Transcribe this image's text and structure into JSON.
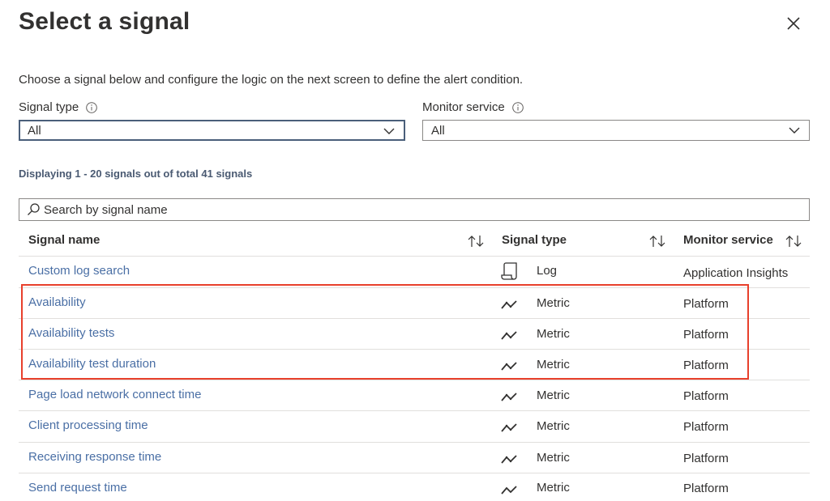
{
  "dialog": {
    "title": "Select a signal",
    "description": "Choose a signal below and configure the logic on the next screen to define the alert condition."
  },
  "filters": {
    "signal_type": {
      "label": "Signal type",
      "value": "All"
    },
    "monitor_service": {
      "label": "Monitor service",
      "value": "All"
    }
  },
  "summary": "Displaying 1 - 20 signals out of total 41 signals",
  "search": {
    "placeholder": "Search by signal name"
  },
  "table": {
    "headers": {
      "name": "Signal name",
      "type": "Signal type",
      "service": "Monitor service"
    },
    "rows": [
      {
        "name": "Custom log search",
        "type": "Log",
        "type_icon": "log-scroll-icon",
        "service": "Application Insights"
      },
      {
        "name": "Availability",
        "type": "Metric",
        "type_icon": "metric-line-icon",
        "service": "Platform"
      },
      {
        "name": "Availability tests",
        "type": "Metric",
        "type_icon": "metric-line-icon",
        "service": "Platform"
      },
      {
        "name": "Availability test duration",
        "type": "Metric",
        "type_icon": "metric-line-icon",
        "service": "Platform"
      },
      {
        "name": "Page load network connect time",
        "type": "Metric",
        "type_icon": "metric-line-icon",
        "service": "Platform"
      },
      {
        "name": "Client processing time",
        "type": "Metric",
        "type_icon": "metric-line-icon",
        "service": "Platform"
      },
      {
        "name": "Receiving response time",
        "type": "Metric",
        "type_icon": "metric-line-icon",
        "service": "Platform"
      },
      {
        "name": "Send request time",
        "type": "Metric",
        "type_icon": "metric-line-icon",
        "service": "Platform"
      }
    ]
  },
  "colors": {
    "link": "#4a6fa5",
    "highlight_border": "#e8402c",
    "text": "#323130",
    "summary": "#4a5a72"
  }
}
